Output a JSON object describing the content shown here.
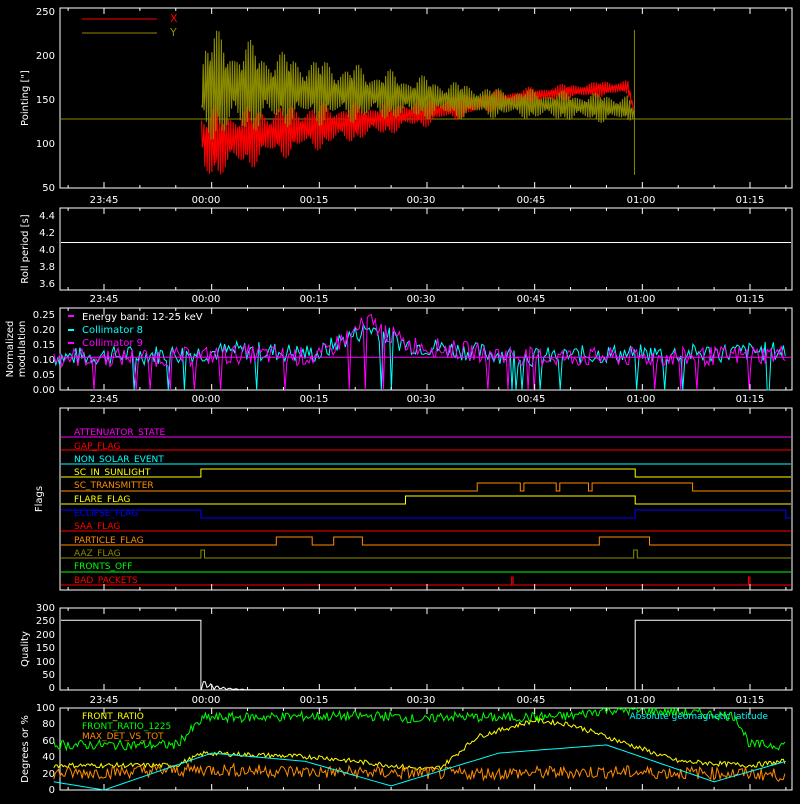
{
  "x_tick_labels": [
    "23:45",
    "00:00",
    "00:15",
    "00:30",
    "00:45",
    "01:00",
    "01:15"
  ],
  "panels": {
    "pointing": {
      "ylabel": "Pointing [\"]",
      "yticks": [
        "50",
        "100",
        "150",
        "200",
        "250"
      ],
      "legend": [
        {
          "label": "X",
          "color": "#ff0000"
        },
        {
          "label": "Y",
          "color": "#8b8b00"
        }
      ]
    },
    "roll": {
      "ylabel": "Roll period [s]",
      "yticks": [
        "3.6",
        "3.8",
        "4.0",
        "4.2",
        "4.4"
      ]
    },
    "modulation": {
      "ylabel_line1": "Normalized",
      "ylabel_line2": "modulation",
      "yticks": [
        "0.00",
        "0.05",
        "0.10",
        "0.15",
        "0.20",
        "0.25"
      ],
      "legend": [
        {
          "label": "Energy band: 12-25 keV",
          "color": "#ffffff"
        },
        {
          "label": "Collimator 8",
          "color": "#00ffff"
        },
        {
          "label": "Collimator 9",
          "color": "#ff00ff"
        }
      ]
    },
    "flags": {
      "ylabel": "Flags",
      "rows": [
        {
          "label": "ATTENUATOR_STATE",
          "color": "#ff00ff"
        },
        {
          "label": "GAP_FLAG",
          "color": "#ff0000"
        },
        {
          "label": "NON_SOLAR_EVENT",
          "color": "#00ffff"
        },
        {
          "label": "SC_IN_SUNLIGHT",
          "color": "#ffff00"
        },
        {
          "label": "SC_TRANSMITTER",
          "color": "#ff8c00"
        },
        {
          "label": "FLARE_FLAG",
          "color": "#ffff00"
        },
        {
          "label": "ECLIPSE_FLAG",
          "color": "#0000ff"
        },
        {
          "label": "SAA_FLAG",
          "color": "#ff0000"
        },
        {
          "label": "PARTICLE_FLAG",
          "color": "#ff8c00"
        },
        {
          "label": "AAZ_FLAG",
          "color": "#8b8b00"
        },
        {
          "label": "FRONTS_OFF",
          "color": "#00ff00"
        },
        {
          "label": "BAD_PACKETS",
          "color": "#ff0000"
        }
      ]
    },
    "quality": {
      "ylabel": "Quality",
      "yticks": [
        "0",
        "50",
        "100",
        "150",
        "200",
        "250",
        "300"
      ]
    },
    "ratio": {
      "ylabel": "Degrees or %",
      "yticks": [
        "0",
        "20",
        "40",
        "60",
        "80",
        "100"
      ],
      "legend": [
        {
          "label": "FRONT_RATIO",
          "color": "#ffff00"
        },
        {
          "label": "FRONT_RATIO_1225",
          "color": "#00ff00"
        },
        {
          "label": "MAX_DET_VS_TOT",
          "color": "#ff8c00"
        }
      ],
      "right_legend": {
        "label": "Absolute geomagnetic latitude",
        "color": "#00ffff"
      }
    }
  },
  "chart_data": [
    {
      "type": "line",
      "ylabel": "Pointing [\"]",
      "ylim": [
        45,
        250
      ],
      "x_unit": "minutes after 23:45",
      "x_range": [
        -7,
        95
      ],
      "series": [
        {
          "name": "X",
          "x": [
            -7,
            13,
            14,
            25,
            40,
            55,
            65,
            73,
            74,
            95
          ],
          "y": [
            128,
            128,
            95,
            110,
            125,
            145,
            155,
            160,
            128,
            128
          ],
          "envelope_half_width": [
            0,
            0,
            45,
            32,
            20,
            12,
            10,
            10,
            0,
            0
          ]
        },
        {
          "name": "Y",
          "x": [
            -7,
            13,
            14,
            25,
            40,
            55,
            65,
            73,
            74,
            95
          ],
          "y": [
            128,
            128,
            160,
            158,
            150,
            142,
            138,
            135,
            128,
            128
          ],
          "envelope_half_width": [
            0,
            0,
            70,
            45,
            30,
            18,
            18,
            18,
            0,
            0
          ]
        }
      ]
    },
    {
      "type": "line",
      "ylabel": "Roll period [s]",
      "ylim": [
        3.5,
        4.5
      ],
      "series": [
        {
          "name": "",
          "x": [
            -7,
            95
          ],
          "y": [
            4.08,
            4.08
          ]
        }
      ]
    },
    {
      "type": "line",
      "ylabel": "Normalized modulation",
      "ylim": [
        0,
        0.25
      ],
      "series": [
        {
          "name": "Collimator 8",
          "x": [
            -7,
            10,
            20,
            30,
            33,
            37,
            42,
            50,
            60,
            70,
            80,
            95
          ],
          "y": [
            0.1,
            0.11,
            0.12,
            0.11,
            0.15,
            0.19,
            0.14,
            0.12,
            0.1,
            0.11,
            0.11,
            0.12
          ]
        },
        {
          "name": "Collimator 9",
          "x": [
            -7,
            10,
            20,
            30,
            33,
            37,
            42,
            50,
            60,
            70,
            80,
            95
          ],
          "y": [
            0.1,
            0.1,
            0.11,
            0.1,
            0.15,
            0.21,
            0.14,
            0.12,
            0.1,
            0.1,
            0.1,
            0.11
          ]
        }
      ]
    },
    {
      "type": "step",
      "ylabel": "Flags",
      "series": [
        {
          "name": "ATTENUATOR_STATE",
          "segments_high": []
        },
        {
          "name": "GAP_FLAG",
          "segments_high": []
        },
        {
          "name": "NON_SOLAR_EVENT",
          "segments_high": []
        },
        {
          "name": "SC_IN_SUNLIGHT",
          "segments_high": [
            [
              13.5,
              74
            ]
          ]
        },
        {
          "name": "SC_TRANSMITTER",
          "segments_high": [
            [
              52,
              58
            ],
            [
              58.5,
              63
            ],
            [
              63.5,
              67.5
            ],
            [
              68,
              82
            ]
          ]
        },
        {
          "name": "FLARE_FLAG",
          "segments_high": [
            [
              42,
              74
            ]
          ]
        },
        {
          "name": "ECLIPSE_FLAG",
          "segments_high": [
            [
              -7,
              13.5
            ],
            [
              74,
              95
            ]
          ]
        },
        {
          "name": "SAA_FLAG",
          "segments_high": []
        },
        {
          "name": "PARTICLE_FLAG",
          "segments_high": [
            [
              24,
              29
            ],
            [
              32,
              36
            ],
            [
              69,
              76
            ]
          ]
        },
        {
          "name": "AAZ_FLAG",
          "segments_high": [
            [
              13.5,
              14
            ],
            [
              73.8,
              74.3
            ]
          ]
        },
        {
          "name": "FRONTS_OFF",
          "segments_high": []
        },
        {
          "name": "BAD_PACKETS",
          "segments_high": [
            [
              56.8,
              57
            ],
            [
              89.8,
              90
            ]
          ]
        }
      ]
    },
    {
      "type": "line",
      "ylabel": "Quality",
      "ylim": [
        0,
        300
      ],
      "series": [
        {
          "name": "",
          "x": [
            -7,
            13.5,
            13.6,
            20,
            74,
            74.1,
            95
          ],
          "y": [
            255,
            255,
            30,
            0,
            0,
            255,
            255
          ]
        }
      ]
    },
    {
      "type": "line",
      "ylabel": "Degrees or %",
      "ylim": [
        0,
        100
      ],
      "series": [
        {
          "name": "FRONT_RATIO",
          "x": [
            -7,
            10,
            14,
            30,
            40,
            45,
            47,
            52,
            60,
            65,
            70,
            80,
            90,
            95
          ],
          "y": [
            30,
            30,
            45,
            40,
            30,
            25,
            28,
            65,
            85,
            80,
            65,
            35,
            30,
            35
          ]
        },
        {
          "name": "FRONT_RATIO_1225",
          "x": [
            -7,
            10,
            14,
            30,
            40,
            45,
            47,
            55,
            65,
            70,
            80,
            88,
            90,
            95
          ],
          "y": [
            55,
            55,
            88,
            90,
            90,
            85,
            90,
            88,
            90,
            98,
            95,
            90,
            55,
            55
          ]
        },
        {
          "name": "MAX_DET_VS_TOT",
          "x": [
            -7,
            14,
            30,
            50,
            70,
            90,
            95
          ],
          "y": [
            20,
            25,
            22,
            20,
            22,
            20,
            18
          ]
        },
        {
          "name": "Absolute geomagnetic latitude",
          "x": [
            -7,
            0,
            15,
            28,
            40,
            55,
            70,
            85,
            95
          ],
          "y": [
            10,
            0,
            45,
            35,
            5,
            45,
            55,
            10,
            35
          ]
        }
      ]
    }
  ]
}
